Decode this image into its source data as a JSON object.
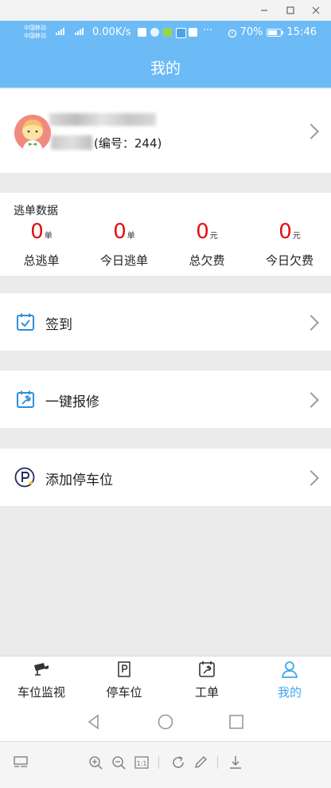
{
  "status_bar": {
    "carrier_1": "中国移动",
    "carrier_2": "中国移动",
    "net_speed": "0.00K/s",
    "battery": "70%",
    "time": "15:46",
    "more": "···"
  },
  "header": {
    "title": "我的"
  },
  "profile": {
    "user_id": "(编号：244)"
  },
  "stats": {
    "title": "逃单数据",
    "items": [
      {
        "value": "0",
        "unit": "单",
        "label": "总逃单"
      },
      {
        "value": "0",
        "unit": "单",
        "label": "今日逃单"
      },
      {
        "value": "0",
        "unit": "元",
        "label": "总欠费"
      },
      {
        "value": "0",
        "unit": "元",
        "label": "今日欠费"
      }
    ]
  },
  "menu": {
    "items": [
      {
        "label": "签到",
        "icon": "calendar-check-icon"
      },
      {
        "label": "一键报修",
        "icon": "repair-wrench-icon"
      },
      {
        "label": "添加停车位",
        "icon": "parking-p-icon"
      }
    ]
  },
  "bottom_nav": {
    "items": [
      {
        "label": "车位监视",
        "icon": "camera-icon"
      },
      {
        "label": "停车位",
        "icon": "parking-sign-icon"
      },
      {
        "label": "工单",
        "icon": "work-order-icon"
      },
      {
        "label": "我的",
        "icon": "user-icon",
        "active": true
      }
    ]
  },
  "colors": {
    "header_blue": "#6cbbf7",
    "stat_red": "#e30f0f",
    "active_tab": "#3ea7ec"
  }
}
